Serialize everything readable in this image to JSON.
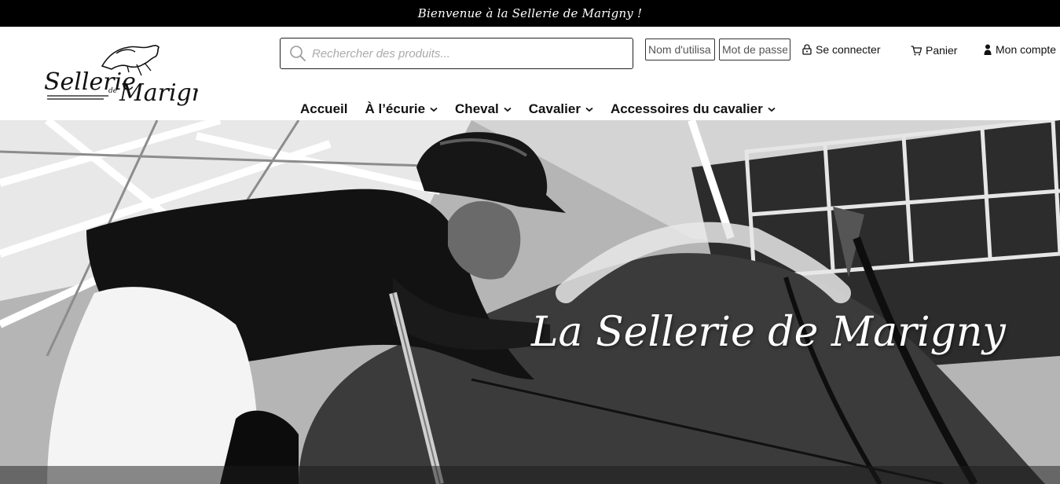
{
  "announcement": "Bienvenue à la Sellerie de Marigny !",
  "logo": {
    "text_main": "Sellerie",
    "text_small": "de",
    "text_brand": "Marigny"
  },
  "search": {
    "placeholder": "Rechercher des produits...",
    "icon": "search-icon"
  },
  "login": {
    "username_placeholder": "Nom d'utilisa",
    "password_placeholder": "Mot de passe",
    "login_label": "Se connecter",
    "login_icon": "lock-icon"
  },
  "cart": {
    "label": "Panier",
    "icon": "cart-icon"
  },
  "account": {
    "label": "Mon compte",
    "icon": "user-icon"
  },
  "nav": {
    "items": [
      {
        "label": "Accueil",
        "has_submenu": false
      },
      {
        "label": "À l’écurie",
        "has_submenu": true
      },
      {
        "label": "Cheval",
        "has_submenu": true
      },
      {
        "label": "Cavalier",
        "has_submenu": true
      },
      {
        "label": "Accessoires du cavalier",
        "has_submenu": true
      }
    ]
  },
  "hero": {
    "title": "La Sellerie de Marigny"
  },
  "colors": {
    "topbar_bg": "#000000",
    "topbar_text": "#ffffff",
    "text": "#111111",
    "border": "#222222"
  }
}
